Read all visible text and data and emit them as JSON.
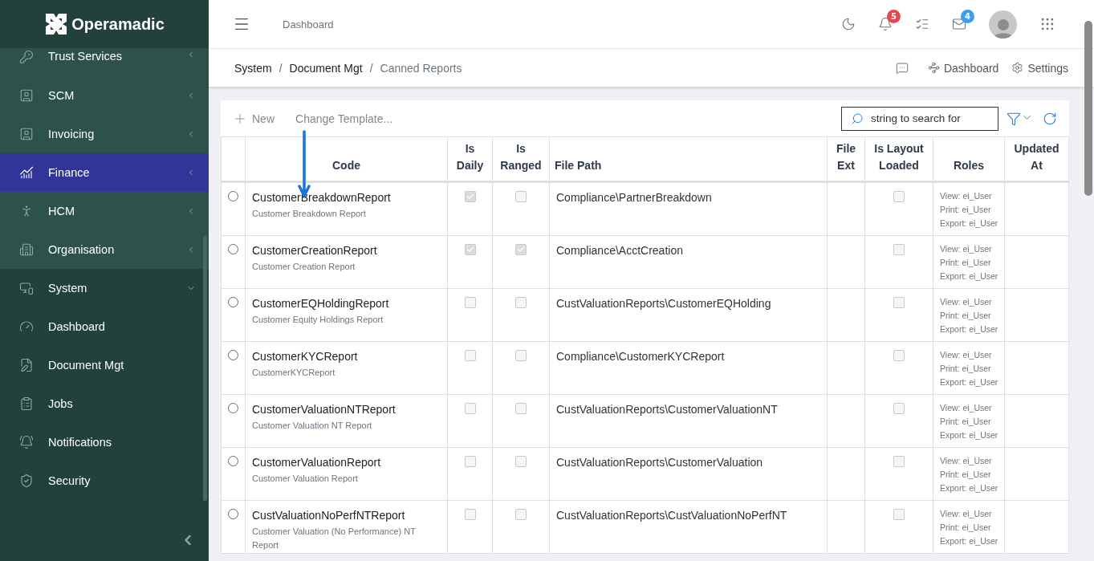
{
  "brand": "Operamadic",
  "sidebar": {
    "items": [
      {
        "label": "Trust Services",
        "selected": false,
        "expanded": false
      },
      {
        "label": "SCM",
        "selected": false,
        "expanded": false
      },
      {
        "label": "Invoicing",
        "selected": false,
        "expanded": false
      },
      {
        "label": "Finance",
        "selected": true,
        "expanded": false
      },
      {
        "label": "HCM",
        "selected": false,
        "expanded": false
      },
      {
        "label": "Organisation",
        "selected": false,
        "expanded": false
      },
      {
        "label": "System",
        "selected": false,
        "expanded": true,
        "children": [
          {
            "label": "Dashboard",
            "selected": false
          },
          {
            "label": "Document Mgt",
            "selected": false
          },
          {
            "label": "Jobs",
            "selected": false
          },
          {
            "label": "Notifications",
            "selected": false
          },
          {
            "label": "Security",
            "selected": false
          }
        ]
      }
    ]
  },
  "header": {
    "page": "Dashboard",
    "notification_count": "5",
    "message_count": "4"
  },
  "breadcrumb": [
    "System",
    "Document Mgt",
    "Canned Reports"
  ],
  "breadcrumb_separator": "/",
  "page_actions": [
    "Dashboard",
    "Settings"
  ],
  "toolbar": {
    "new": "New",
    "change_template": "Change Template...",
    "search": {
      "placeholder": "string to search for"
    }
  },
  "table": {
    "columns": [
      "Code",
      "Is Daily",
      "Is Ranged",
      "File Path",
      "File Ext",
      "Is Layout Loaded",
      "Roles",
      "Updated At"
    ],
    "rows": [
      {
        "selected": false,
        "code": "CustomerBreakdownReport",
        "description": "Customer Breakdown Report",
        "is_daily": true,
        "is_ranged": false,
        "file_path": "Compliance\\PartnerBreakdown",
        "layout_loaded": false,
        "roles": [
          "View: ei_User",
          "Print: ei_User",
          "Export: ei_User"
        ]
      },
      {
        "selected": false,
        "code": "CustomerCreationReport",
        "description": "Customer Creation Report",
        "is_daily": true,
        "is_ranged": true,
        "file_path": "Compliance\\AcctCreation",
        "layout_loaded": false,
        "roles": [
          "View: ei_User",
          "Print: ei_User",
          "Export: ei_User"
        ]
      },
      {
        "selected": false,
        "code": "CustomerEQHoldingReport",
        "description": "Customer Equity Holdings Report",
        "is_daily": false,
        "is_ranged": false,
        "file_path": "CustValuationReports\\CustomerEQHolding",
        "layout_loaded": false,
        "roles": [
          "View: ei_User",
          "Print: ei_User",
          "Export: ei_User"
        ]
      },
      {
        "selected": false,
        "code": "CustomerKYCReport",
        "description": "CustomerKYCReport",
        "is_daily": false,
        "is_ranged": false,
        "file_path": "Compliance\\CustomerKYCReport",
        "layout_loaded": false,
        "roles": [
          "View: ei_User",
          "Print: ei_User",
          "Export: ei_User"
        ]
      },
      {
        "selected": false,
        "code": "CustomerValuationNTReport",
        "description": "Customer Valuation NT Report",
        "is_daily": false,
        "is_ranged": false,
        "file_path": "CustValuationReports\\CustomerValuationNT",
        "layout_loaded": false,
        "roles": [
          "View: ei_User",
          "Print: ei_User",
          "Export: ei_User"
        ]
      },
      {
        "selected": false,
        "code": "CustomerValuationReport",
        "description": "Customer Valuation Report",
        "is_daily": false,
        "is_ranged": false,
        "file_path": "CustValuationReports\\CustomerValuation",
        "layout_loaded": false,
        "roles": [
          "View: ei_User",
          "Print: ei_User",
          "Export: ei_User"
        ]
      },
      {
        "selected": false,
        "code": "CustValuationNoPerfNTReport",
        "description": "Customer Valuation (No Performance) NT Report",
        "is_daily": false,
        "is_ranged": false,
        "file_path": "CustValuationReports\\CustValuationNoPerfNT",
        "layout_loaded": false,
        "roles": [
          "View: ei_User",
          "Print: ei_User",
          "Export: ei_User"
        ]
      }
    ]
  }
}
